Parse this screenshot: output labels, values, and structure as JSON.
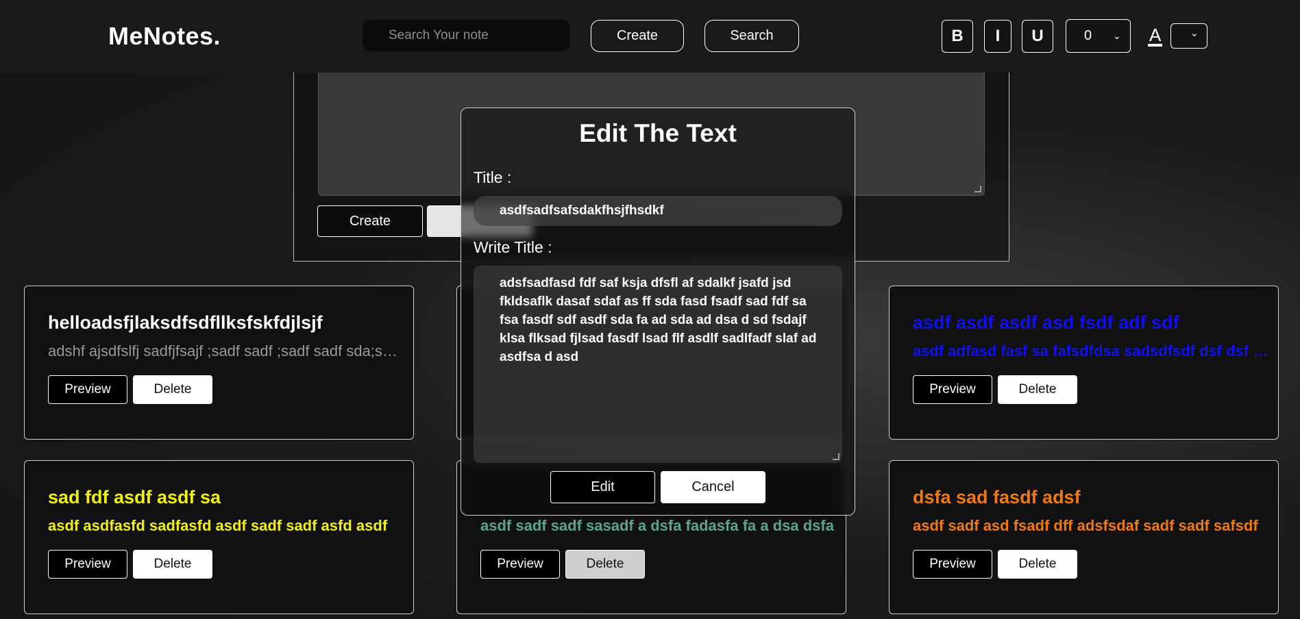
{
  "nav": {
    "brand": "MeNotes.",
    "search_placeholder": "Search Your note",
    "create_label": "Create",
    "search_label": "Search",
    "bold_label": "B",
    "italic_label": "I",
    "underline_label": "U",
    "font_size_value": "0",
    "font_color_label": "A"
  },
  "create_panel": {
    "create_label": "Create"
  },
  "notes": [
    {
      "title": "helloadsfjlaksdfsdfllksfskfdjlsjf",
      "body": "adshf ajsdfslfj sadfjfsajf ;sadf sadf ;sadf sadf sda;sadf sadf",
      "title_color": "#ffffff",
      "body_color": "#9a9a9a",
      "body_bold": false,
      "preview_label": "Preview",
      "delete_label": "Delete"
    },
    {
      "title": "",
      "body": "",
      "title_color": "#ffffff",
      "body_color": "#ffffff",
      "body_bold": true,
      "preview_label": "",
      "delete_label": ""
    },
    {
      "title": "asdf asdf asdf asd fsdf adf sdf",
      "body": "asdf adfasd fasf sa fafsdfdsa sadsdfsdf dsf dsf sdf",
      "title_color": "#1010f0",
      "body_color": "#1010f0",
      "body_bold": true,
      "preview_label": "Preview",
      "delete_label": "Delete"
    },
    {
      "title": "sad fdf asdf asdf sa",
      "body": "asdf asdfasfd sadfasfd asdf sadf sadf asfd asdf",
      "title_color": "#f2f20f",
      "body_color": "#f2f20f",
      "body_bold": true,
      "preview_label": "Preview",
      "delete_label": "Delete"
    },
    {
      "title": "",
      "body": "asdf sadf sadf sasadf a dsfa fadasfa fa a dsa dsfa",
      "title_color": "#3f9f3f",
      "body_color": "#5aa58c",
      "body_bold": true,
      "preview_label": "Preview",
      "delete_label": "Delete"
    },
    {
      "title": "dsfa sad fasdf adsf",
      "body": "asdf sadf asd fsadf dff adsfsdaf sadf sadf safsdf",
      "title_color": "#f07a10",
      "body_color": "#f07a10",
      "body_bold": true,
      "preview_label": "Preview",
      "delete_label": "Delete"
    }
  ],
  "modal": {
    "heading": "Edit The Text",
    "title_label": "Title :",
    "title_value": "asdfsadfsafsdakfhsjfhsdkf",
    "body_label": "Write Title :",
    "body_value": "adsfsadfasd fdf saf ksja dfsfl af sdalkf jsafd jsd fkldsaflk dasaf sdaf as ff sda fasd fsadf sad fdf sa fsa fasdf sdf asdf sda fa ad sda  ad dsa  d sd fsdajf klsa flksad fjlsad fasdf lsad flf asdlf sadlfadf slaf ad asdfsa d asd",
    "edit_label": "Edit",
    "cancel_label": "Cancel"
  }
}
